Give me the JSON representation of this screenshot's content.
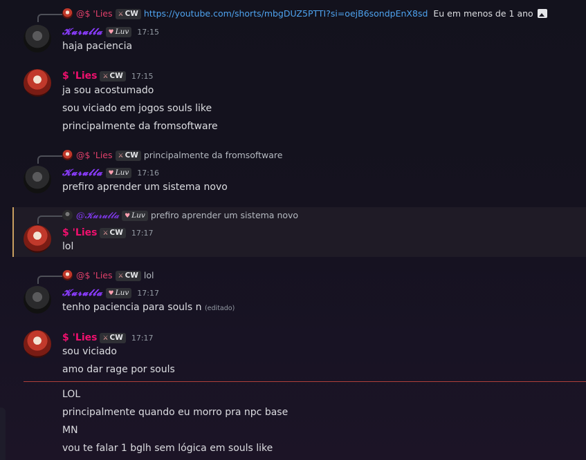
{
  "messages": [
    {
      "reply": {
        "author": "@$ 'Lies",
        "tag": "CW",
        "text": "https://youtube.com/shorts/mbgDUZ5PTTI?si=oejB6sondpEnX8sd",
        "suffix": "Eu em menos de 1 ano"
      },
      "author": "𝓚𝓾𝓻𝓾𝓵𝓵𝓪",
      "tag": "Luv",
      "time": "17:15",
      "lines": [
        "haja paciencia"
      ]
    },
    {
      "author": "$ 'Lies",
      "tag": "CW",
      "time": "17:15",
      "lines": [
        "ja sou acostumado",
        "sou viciado em jogos souls like",
        "principalmente da fromsoftware"
      ]
    },
    {
      "reply": {
        "author": "@$ 'Lies",
        "tag": "CW",
        "text": "principalmente da fromsoftware"
      },
      "author": "𝓚𝓾𝓻𝓾𝓵𝓵𝓪",
      "tag": "Luv",
      "time": "17:16",
      "lines": [
        "prefiro aprender um sistema novo"
      ]
    },
    {
      "reply": {
        "author": "@𝓚𝓾𝓻𝓾𝓵𝓵𝓪",
        "tag": "Luv",
        "text": "prefiro aprender um sistema novo"
      },
      "author": "$ 'Lies",
      "tag": "CW",
      "time": "17:17",
      "lines": [
        "lol"
      ]
    },
    {
      "reply": {
        "author": "@$ 'Lies",
        "tag": "CW",
        "text": "lol"
      },
      "author": "𝓚𝓾𝓻𝓾𝓵𝓵𝓪",
      "tag": "Luv",
      "time": "17:17",
      "lines": [
        "tenho paciencia para souls n"
      ],
      "edited": "(editado)"
    },
    {
      "author": "$ 'Lies",
      "tag": "CW",
      "time": "17:17",
      "lines": [
        "sou viciado",
        "amo dar rage por souls"
      ]
    }
  ],
  "after_divider": [
    "LOL",
    "principalmente quando eu morro pra npc base",
    "MN",
    "vou te falar 1 bglh sem lógica em souls like"
  ],
  "colors": {
    "lies": "#f0106e",
    "kurulla": "#8a3cff",
    "link": "#4ea3ef",
    "divider": "#b0403a"
  }
}
